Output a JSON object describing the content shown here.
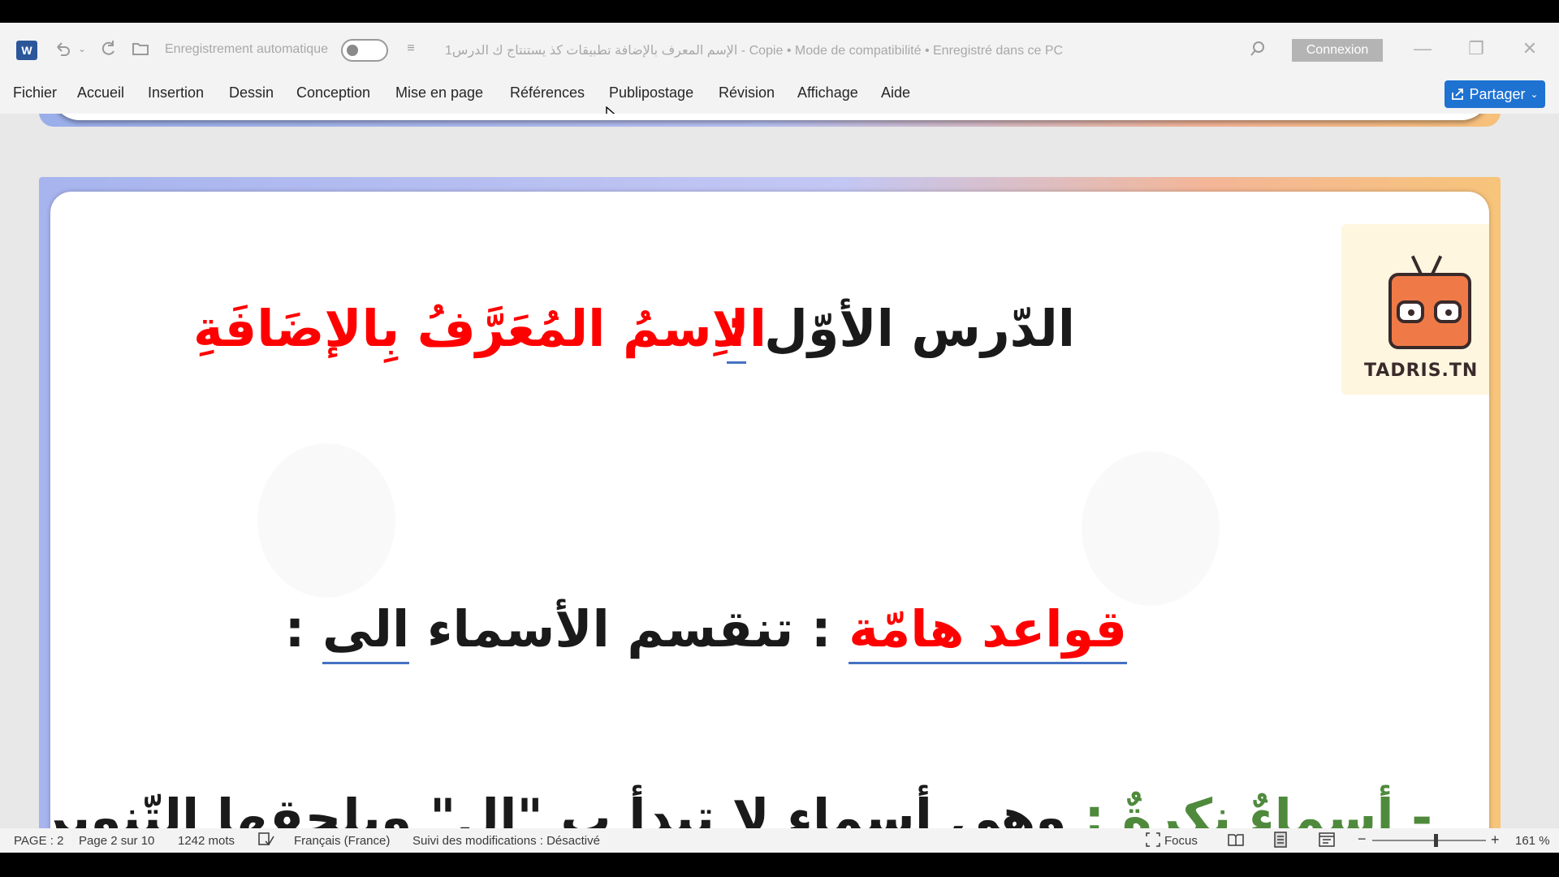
{
  "titlebar": {
    "autosave_label": "Enregistrement automatique",
    "document_title": "الإسم المعرف بالإضافة تطبيقات كذ يستنتاج ك الدرس1 - Copie  •  Mode de compatibilité  •  Enregistré dans ce PC",
    "connexion_label": "Connexion",
    "icons": [
      "word-icon",
      "undo-icon",
      "redo-icon",
      "open-icon",
      "search-icon",
      "minimize-icon",
      "restore-icon",
      "close-icon"
    ]
  },
  "menu": {
    "items": [
      "Fichier",
      "Accueil",
      "Insertion",
      "Dessin",
      "Conception",
      "Mise en page",
      "Références",
      "Publipostage",
      "Révision",
      "Affichage",
      "Aide"
    ],
    "share_label": "Partager"
  },
  "document": {
    "lesson_prefix": "الدّرس الأوّل",
    "colon1": ":",
    "lesson_title": "الاِسمُ المُعَرَّفُ بِالإضَافَةِ",
    "rules_label": "قواعد هامّة",
    "colon2": ":",
    "rules_text": "تنقسم الأسماء",
    "rules_to": "الى",
    "colon3": ":",
    "dash": "-",
    "indefinite_label": "أسماءٌ نكرةٌ",
    "colon4": ":",
    "definition_text": "وهي أسماء لا تبدأ ب",
    "al_quote": "\"ال\"",
    "definition_rest": "ويلحقها التّنوين في",
    "logo_text": "TADRIS.TN",
    "colors": {
      "title_red": "#ff0000",
      "body_black": "#1a1a1a",
      "label_green": "#4f8a3c",
      "underline_blue": "#4472c4"
    }
  },
  "statusbar": {
    "page_field": "PAGE : 2",
    "page_of": "Page 2 sur 10",
    "word_count": "1242 mots",
    "language": "Français (France)",
    "track_changes": "Suivi des modifications : Désactivé",
    "focus_label": "Focus",
    "zoom_minus": "−",
    "zoom_plus": "+",
    "zoom_level": "161 %"
  }
}
